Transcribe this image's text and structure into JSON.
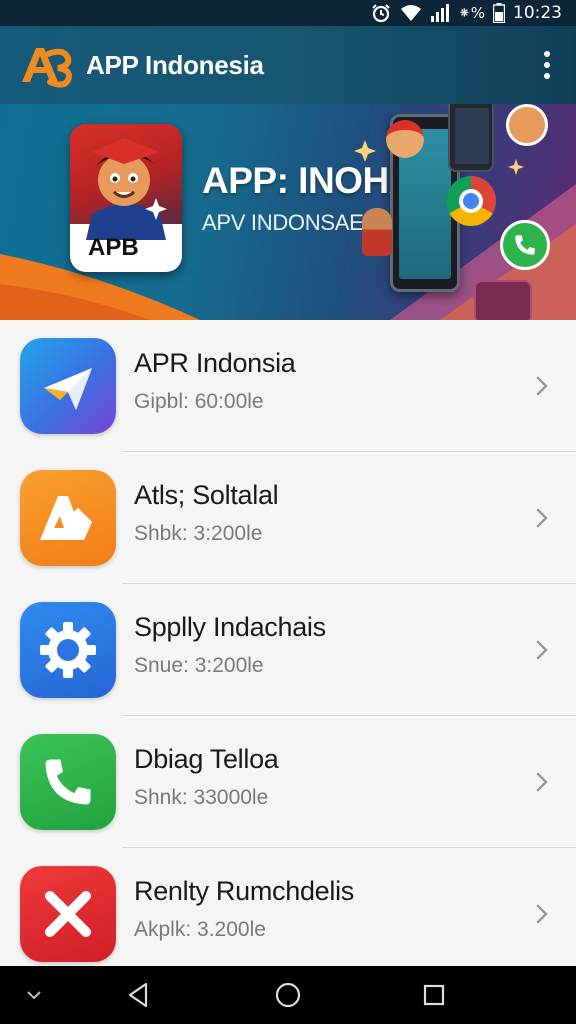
{
  "status_bar": {
    "signal_text": "⁕%",
    "time": "10:23",
    "icons": [
      "alarm-icon",
      "wifi-icon",
      "signal-icon",
      "battery-icon"
    ]
  },
  "app_bar": {
    "title": "APP Indonesia",
    "logo_icon": "app-logo-icon",
    "menu_icon": "more-vert-icon"
  },
  "banner": {
    "title": "APP: INOHAN",
    "subtitle": "APV INDONSAE",
    "logo_label": "APB"
  },
  "apps": [
    {
      "name": "APR Indonsia",
      "meta": "Gipbl: 60:00le",
      "icon": "send-arrow-icon",
      "color": "#2f6fe0"
    },
    {
      "name": "Atls; Soltalal",
      "meta": "Shbk: 3:200le",
      "icon": "lettermark-icon",
      "color": "#f28a1f"
    },
    {
      "name": "Spplly Indachais",
      "meta": "Snue: 3:200le",
      "icon": "gear-icon",
      "color": "#2e7be6"
    },
    {
      "name": "Dbiag Telloa",
      "meta": "Shnk: 33000le",
      "icon": "phone-icon",
      "color": "#2fb34b"
    },
    {
      "name": "Renlty Rumchdelis",
      "meta": "Akplk: 3.200le",
      "icon": "close-x-icon",
      "color": "#e0262f"
    }
  ],
  "nav_bar": {
    "icons": [
      "chevron-down-icon",
      "back-icon",
      "home-icon",
      "recents-icon"
    ]
  }
}
